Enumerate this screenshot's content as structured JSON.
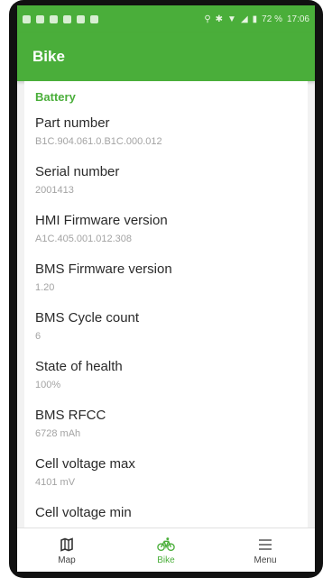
{
  "status_bar": {
    "battery_text": "72 %",
    "time": "17:06"
  },
  "app_bar": {
    "title": "Bike"
  },
  "section": {
    "title": "Battery"
  },
  "rows": [
    {
      "label": "Part number",
      "value": "B1C.904.061.0.B1C.000.012"
    },
    {
      "label": "Serial number",
      "value": "2001413"
    },
    {
      "label": "HMI Firmware version",
      "value": "A1C.405.001.012.308"
    },
    {
      "label": "BMS Firmware version",
      "value": "1.20"
    },
    {
      "label": "BMS Cycle count",
      "value": "6"
    },
    {
      "label": "State of health",
      "value": "100%"
    },
    {
      "label": "BMS RFCC",
      "value": "6728 mAh"
    },
    {
      "label": "Cell voltage max",
      "value": "4101 mV"
    },
    {
      "label": "Cell voltage min",
      "value": ""
    }
  ],
  "bottom_nav": {
    "items": [
      {
        "label": "Map",
        "icon": "map-icon",
        "active": false
      },
      {
        "label": "Bike",
        "icon": "bike-icon",
        "active": true
      },
      {
        "label": "Menu",
        "icon": "menu-icon",
        "active": false
      }
    ]
  },
  "colors": {
    "accent": "#4aae3a",
    "label": "#2a2a2a",
    "value": "#a3a3a3"
  }
}
